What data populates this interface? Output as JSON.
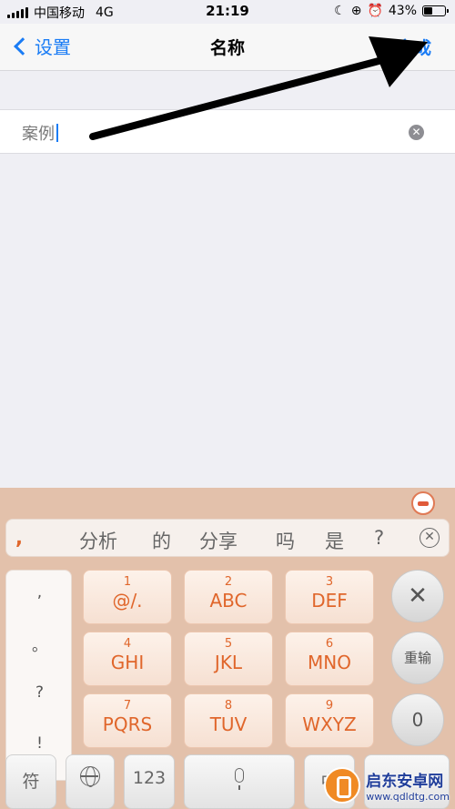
{
  "status_bar": {
    "carrier": "中国移动",
    "network": "4G",
    "time": "21:19",
    "battery_percent": "43%",
    "battery_level": 0.43
  },
  "nav": {
    "back_label": "设置",
    "title": "名称",
    "done_label": "完成"
  },
  "field": {
    "value": "案例"
  },
  "keyboard": {
    "candidates": [
      ",",
      "分析",
      "的",
      "分享",
      "吗",
      "是",
      "?"
    ],
    "punctuation": [
      ",",
      "。",
      "?",
      "!"
    ],
    "keys": [
      {
        "num": "1",
        "letters": "@/."
      },
      {
        "num": "2",
        "letters": "ABC"
      },
      {
        "num": "3",
        "letters": "DEF"
      },
      {
        "num": "4",
        "letters": "GHI"
      },
      {
        "num": "5",
        "letters": "JKL"
      },
      {
        "num": "6",
        "letters": "MNO"
      },
      {
        "num": "7",
        "letters": "PQRS"
      },
      {
        "num": "8",
        "letters": "TUV"
      },
      {
        "num": "9",
        "letters": "WXYZ"
      }
    ],
    "side_keys": {
      "delete": "✕",
      "retype": "重输",
      "zero": "0"
    },
    "bottom": {
      "symbols": "符",
      "numbers": "123",
      "chinese": "中"
    }
  },
  "watermark": {
    "name": "启东安卓网",
    "url": "www.qdldtg.com"
  },
  "colors": {
    "ios_blue": "#1a7cf5",
    "keyboard_bg": "#e3c1ab",
    "key_text": "#e0662b"
  }
}
